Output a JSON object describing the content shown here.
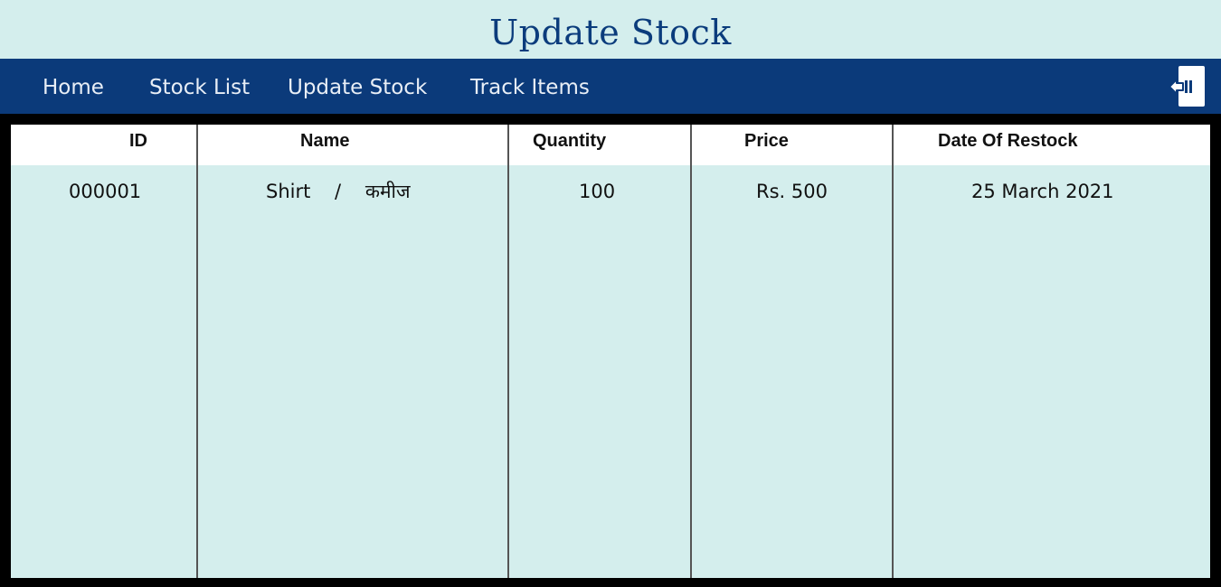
{
  "page": {
    "title": "Update Stock"
  },
  "nav": {
    "items": [
      {
        "label": "Home"
      },
      {
        "label": "Stock List"
      },
      {
        "label": "Update Stock"
      },
      {
        "label": "Track Items"
      }
    ],
    "logout_icon": "logout-icon"
  },
  "table": {
    "columns": [
      "ID",
      "Name",
      "Quantity",
      "Price",
      "Date Of Restock"
    ],
    "rows": [
      {
        "id": "000001",
        "name": "Shirt    /    कमीज",
        "quantity": "100",
        "price": "Rs. 500",
        "date": "25 March 2021"
      }
    ]
  },
  "colors": {
    "background": "#d4eeed",
    "nav": "#0b3a7a",
    "title": "#0b3c7c",
    "frame": "#000000"
  }
}
